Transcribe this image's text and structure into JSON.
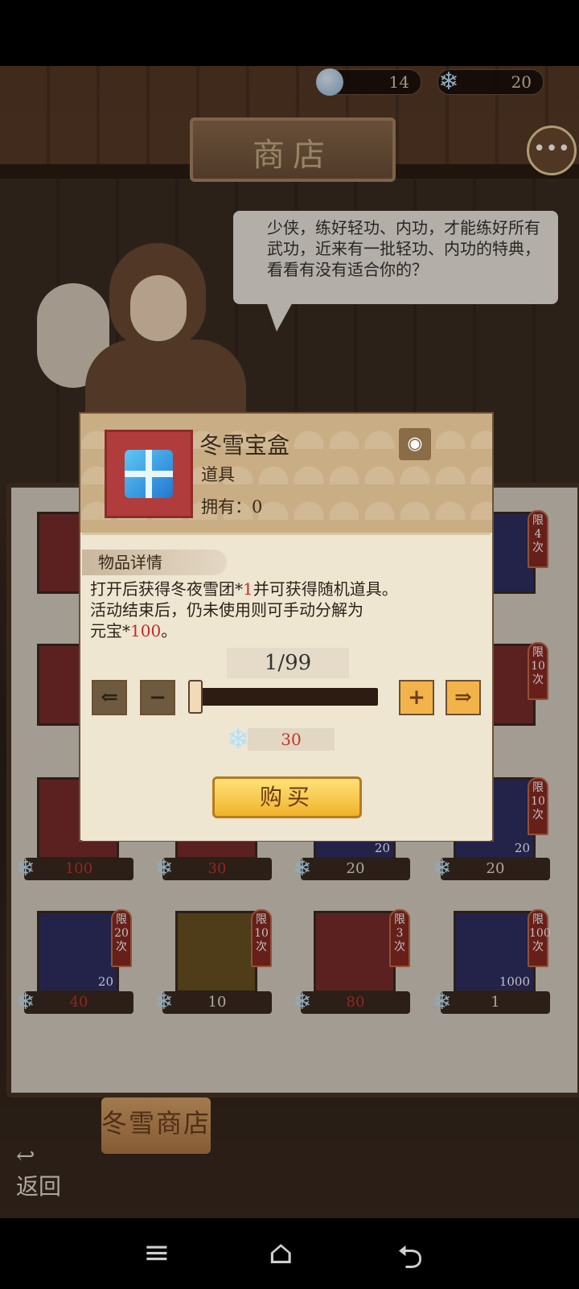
{
  "topbar": {
    "currency1": {
      "icon": "coin-icon",
      "value": "14"
    },
    "currency2": {
      "icon": "snowflake-icon",
      "value": "20"
    }
  },
  "header": {
    "shop_title": "商店"
  },
  "speech": {
    "text": "少侠，练好轻功、内功，才能练好所有武功，近来有一批轻功、内功的特典，看看有没有适合你的？"
  },
  "dialog": {
    "item_name": "冬雪宝盒",
    "item_type": "道具",
    "owned_label": "拥有：0",
    "section_label": "物品详情",
    "desc_line1_a": "打开后获得冬夜雪团",
    "desc_star": "*",
    "desc_line1_qty": "1",
    "desc_line1_b": "并可获得随机道具。",
    "desc_line2": "活动结束后，仍未使用则可手动分解为",
    "desc_line3_a": "元宝",
    "desc_line3_qty": "100",
    "desc_line3_b": "。",
    "quantity": "1/99",
    "cost_value": "30",
    "buy_label": "购买"
  },
  "grid": {
    "row3": [
      {
        "limit": "",
        "count": "",
        "price": "100"
      },
      {
        "limit": "",
        "count": "",
        "price": "30"
      },
      {
        "limit": "",
        "count": "20",
        "price": "20"
      },
      {
        "limit": "限10次",
        "count": "20",
        "price": "20"
      }
    ],
    "row4": [
      {
        "limit": "限20次",
        "count": "20",
        "price": "40"
      },
      {
        "limit": "限10次",
        "count": "",
        "price": "10"
      },
      {
        "limit": "限3次",
        "count": "",
        "price": "80"
      },
      {
        "limit": "限100次",
        "count": "1000",
        "price": "1"
      }
    ],
    "side_limits": {
      "r1": "限4次",
      "r2": "限10次"
    }
  },
  "bottom": {
    "tab": "冬雪商店",
    "back": "返回"
  },
  "navbar": {
    "menu": "≡",
    "home": "⌂",
    "back": "⮌"
  }
}
